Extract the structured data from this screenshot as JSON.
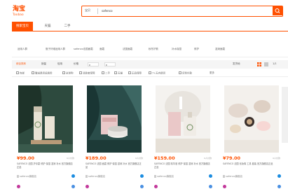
{
  "header": {
    "logo_cn": "淘宝",
    "logo_en": "Taobao",
    "search_scope": "宝贝",
    "search_value": "safenco"
  },
  "tabs": [
    {
      "label": "搜索宝贝",
      "active": true
    },
    {
      "label": "天猫",
      "active": false
    },
    {
      "label": "二手",
      "active": false
    }
  ],
  "filters": [
    "适用人群",
    "瓶子纤维适用人群",
    "safenco法国面霜",
    "面霜",
    "法国面霜",
    "秋冬护肤",
    "补水保湿",
    "修护",
    "滋润面霜"
  ],
  "sort": {
    "items": [
      "综合排序",
      "销量",
      "信用",
      "价格"
    ],
    "price_from": "¥",
    "price_to": "¥",
    "ship_from": "发货地",
    "page": "1/1"
  },
  "checks": [
    "包邮",
    "赠送退货运费险",
    "全球购",
    "消费者保障",
    "二手",
    "天猫",
    "正品保障",
    "7+天内退货",
    "货到付款"
  ],
  "more_label": "更多",
  "products": [
    {
      "price": "¥99.00",
      "sales": "0人付款",
      "title": "SAFENCO 法国 护手霜 修护 保湿 滋润 补水 官方旗舰店正品",
      "shop": "safenco旗舰店"
    },
    {
      "price": "¥189.00",
      "sales": "0人付款",
      "title": "SAFENCO 法国 面霜 修护 保湿 滋润 补水 官方旗舰店正品",
      "shop": "safenco旗舰店"
    },
    {
      "price": "¥159.00",
      "sales": "0人付款",
      "title": "SAFENCO 法国 精华液 修护 保湿 滋润 补水 官方旗舰店正品",
      "shop": "safenco旗舰店"
    },
    {
      "price": "¥79.00",
      "sales": "0人付款",
      "title": "SAFENCO 法国 化妆棉 工具 套装 官方旗舰店正品",
      "shop": "safenco旗舰店"
    }
  ],
  "colors": {
    "brand": "#ff5000",
    "price": "#ff5000"
  }
}
